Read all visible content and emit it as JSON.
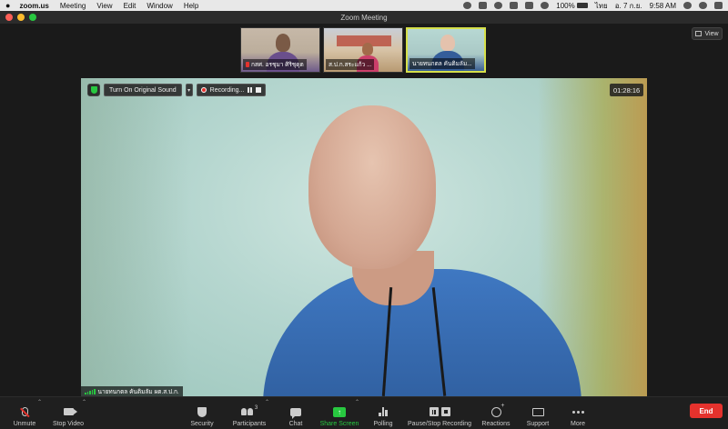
{
  "menubar": {
    "app": "zoom.us",
    "items": [
      "Meeting",
      "View",
      "Edit",
      "Window",
      "Help"
    ],
    "battery": "100%",
    "input_lang": "ไทย",
    "date": "อ. 7 ก.ย.",
    "time": "9:58 AM"
  },
  "window": {
    "title": "Zoom Meeting"
  },
  "gallery": {
    "view_label": "View",
    "participants": [
      {
        "name": "กสศ. อรชุมา ศิริชุดุต",
        "muted": true
      },
      {
        "name": "ส.ป.ก.สระแก้ว ...",
        "muted": false
      },
      {
        "name": "นายทนกตล คันติมลัม...",
        "muted": false,
        "active": true
      }
    ]
  },
  "main_video": {
    "speaker_name": "นายทนกตล คันติมลัม ผต.ส.ป.ก.",
    "sound_button": "Turn On Original Sound",
    "recording_label": "Recording...",
    "timer": "01:28:16"
  },
  "toolbar": {
    "unmute": "Unmute",
    "stop_video": "Stop Video",
    "security": "Security",
    "participants": "Participants",
    "participants_count": "3",
    "chat": "Chat",
    "share_screen": "Share Screen",
    "polling": "Polling",
    "pause_stop_recording": "Pause/Stop Recording",
    "reactions": "Reactions",
    "support": "Support",
    "more": "More",
    "end": "End"
  },
  "colors": {
    "end_red": "#e5322d",
    "share_green": "#28c840",
    "active_border": "#d6e04a"
  }
}
